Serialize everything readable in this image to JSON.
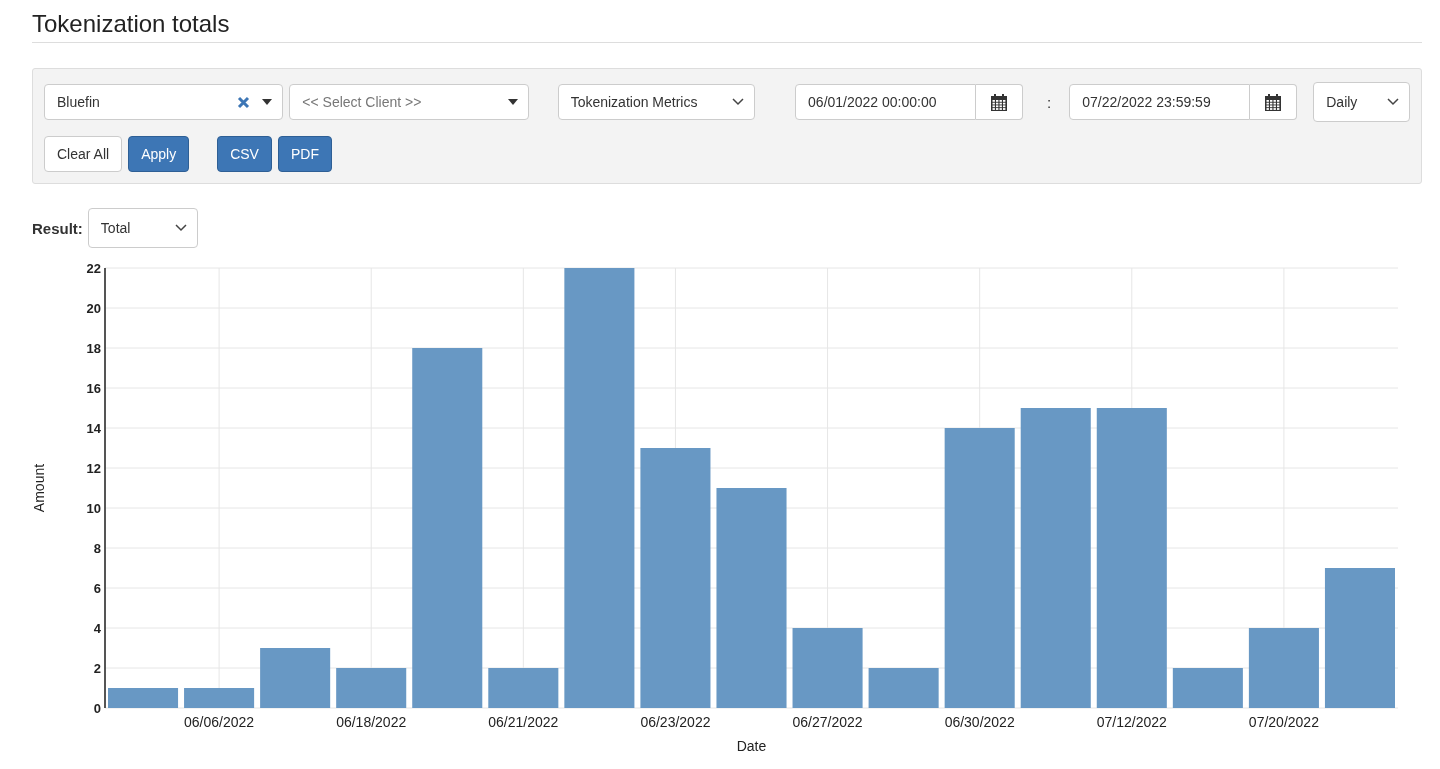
{
  "page_title": "Tokenization totals",
  "filters": {
    "company": {
      "value": "Bluefin"
    },
    "client": {
      "placeholder": "<< Select Client >>"
    },
    "metric": {
      "value": "Tokenization Metrics"
    },
    "start_date": {
      "value": "06/01/2022 00:00:00"
    },
    "range_separator": ":",
    "end_date": {
      "value": "07/22/2022 23:59:59"
    },
    "interval": {
      "value": "Daily"
    }
  },
  "buttons": [
    {
      "label": "Clear All",
      "kind": "default"
    },
    {
      "label": "Apply",
      "kind": "primary"
    },
    {
      "label": "CSV",
      "kind": "export"
    },
    {
      "label": "PDF",
      "kind": "export"
    }
  ],
  "result": {
    "label": "Result:",
    "value": "Total"
  },
  "chart_data": {
    "type": "bar",
    "xlabel": "Date",
    "ylabel": "Amount",
    "categories": [
      null,
      "06/06/2022",
      null,
      "06/18/2022",
      null,
      "06/21/2022",
      null,
      "06/23/2022",
      null,
      "06/27/2022",
      null,
      "06/30/2022",
      null,
      "07/12/2022",
      null,
      "07/20/2022",
      null
    ],
    "series": [
      {
        "color": "#6898c4",
        "values": [
          1,
          1,
          3,
          2,
          18,
          2,
          22,
          13,
          11,
          4,
          2,
          14,
          15,
          15,
          2,
          4,
          7
        ]
      }
    ],
    "grid": true,
    "ylim": [
      0,
      22
    ],
    "yticks": [
      0,
      2,
      4,
      6,
      8,
      10,
      12,
      14,
      16,
      18,
      20,
      22
    ]
  }
}
